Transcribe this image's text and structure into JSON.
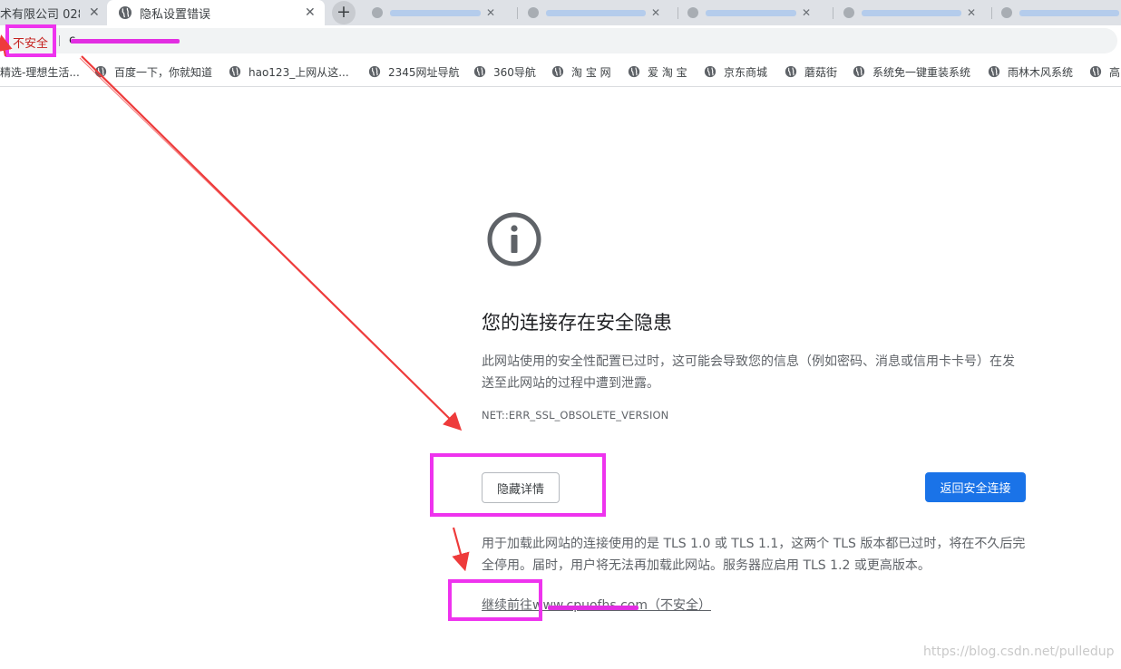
{
  "tabs": {
    "first_title": "术有限公司 028-",
    "active_title": "隐私设置错误",
    "close_glyph": "✕",
    "newtab_glyph": "+"
  },
  "omnibox": {
    "security_label": "不安全",
    "url_visible": "c"
  },
  "bookmarks": [
    {
      "label": "精选-理想生活..."
    },
    {
      "label": "百度一下，你就知道"
    },
    {
      "label": "hao123_上网从这..."
    },
    {
      "label": "2345网址导航"
    },
    {
      "label": "360导航"
    },
    {
      "label": "淘 宝 网"
    },
    {
      "label": "爱 淘 宝"
    },
    {
      "label": "京东商城"
    },
    {
      "label": "蘑菇街"
    },
    {
      "label": "系统免一键重装系统"
    },
    {
      "label": "雨林木风系统"
    },
    {
      "label": "高"
    }
  ],
  "interstitial": {
    "icon": "info-circle-icon",
    "heading": "您的连接存在安全隐患",
    "message": "此网站使用的安全性配置已过时，这可能会导致您的信息（例如密码、消息或信用卡卡号）在发送至此网站的过程中遭到泄露。",
    "error_code": "NET::ERR_SSL_OBSOLETE_VERSION",
    "details_button": "隐藏详情",
    "primary_button": "返回安全连接",
    "details_text": "用于加载此网站的连接使用的是 TLS 1.0 或 TLS 1.1，这两个 TLS 版本都已过时，将在不久后完全停用。届时，用户将无法再加载此网站。服务器应启用 TLS 1.2 或更高版本。",
    "proceed_link": "继续前往www.cpuofhs.com（不安全）"
  },
  "watermark": "https://blog.csdn.net/pulledup",
  "colors": {
    "highlight": "#ee33ee",
    "arrow": "#ee3b3b",
    "primary": "#1a73e8",
    "insecure": "#c5221f"
  }
}
